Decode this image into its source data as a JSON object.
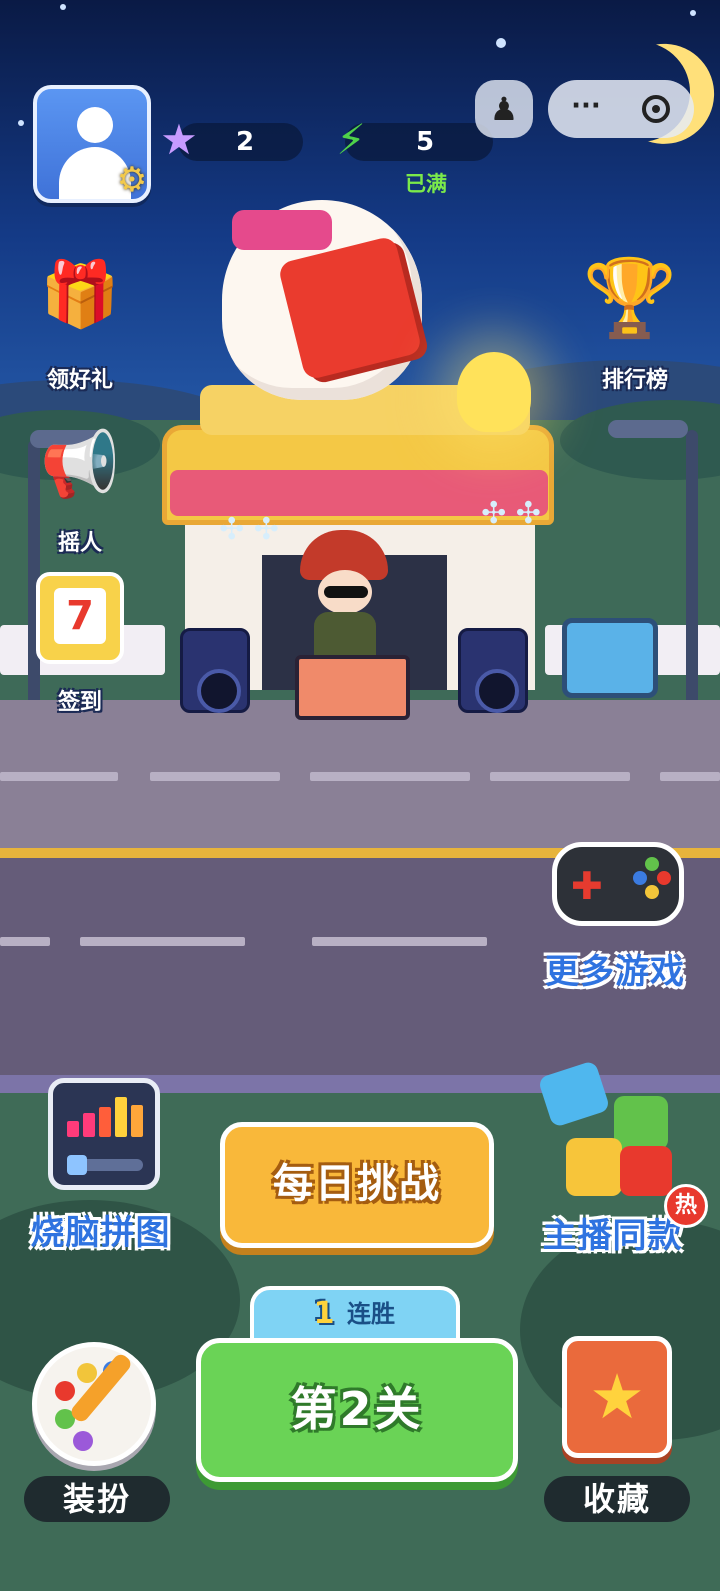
{
  "hud": {
    "stars": "2",
    "energy": "5",
    "energy_status": "已满"
  },
  "top_bar": {
    "joystick_icon": "joystick-icon",
    "more_icon": "more-dots-icon",
    "close_icon": "target-close-icon"
  },
  "side_menu": {
    "gift": "领好礼",
    "invite": "摇人",
    "checkin": "签到",
    "checkin_day": "7",
    "leaderboard": "排行榜",
    "more_games": "更多游戏"
  },
  "modes": {
    "brain_puzzle": "烧脑拼图",
    "daily_challenge": "每日挑战",
    "streamer_same": "主播同款",
    "hot_badge": "热"
  },
  "level": {
    "streak_count": "1",
    "streak_text": "连胜",
    "current_level": "第2关"
  },
  "bottom": {
    "dress_up": "装扮",
    "favorites": "收藏"
  },
  "colors": {
    "accent_green": "#6ad356",
    "accent_yellow": "#f9b83a",
    "brand_blue": "#2f73e0"
  }
}
